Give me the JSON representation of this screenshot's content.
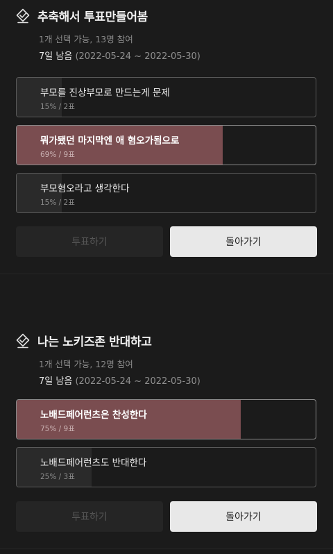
{
  "polls": [
    {
      "title": "추축해서 투표만들어봄",
      "meta": "1개 선택 가능, 13명 참여",
      "days_left": "7일 남음",
      "date_range": "(2022-05-24 ~ 2022-05-30)",
      "options": [
        {
          "label": "부모를 진상부모로 만드는게 문제",
          "stats": "15% / 2표",
          "percent": 15,
          "selected": false
        },
        {
          "label": "뭐가됐던 마지막엔 애 혐오가됨으로",
          "stats": "69% / 9표",
          "percent": 69,
          "selected": true
        },
        {
          "label": "부모혐오라고 생각한다",
          "stats": "15% / 2표",
          "percent": 15,
          "selected": false
        }
      ],
      "vote_label": "투표하기",
      "back_label": "돌아가기"
    },
    {
      "title": "나는 노키즈존 반대하고",
      "meta": "1개 선택 가능, 12명 참여",
      "days_left": "7일 남음",
      "date_range": "(2022-05-24 ~ 2022-05-30)",
      "options": [
        {
          "label": "노배드페어런츠은 찬성한다",
          "stats": "75% / 9표",
          "percent": 75,
          "selected": true
        },
        {
          "label": "노배드페어런츠도 반대한다",
          "stats": "25% / 3표",
          "percent": 25,
          "selected": false
        }
      ],
      "vote_label": "투표하기",
      "back_label": "돌아가기"
    }
  ],
  "colors": {
    "selected_fill": "#7a4d50",
    "unselected_fill": "#2a2a2a",
    "background": "#1b1b1b"
  },
  "icons": {
    "poll_icon": "check-badge-icon"
  }
}
